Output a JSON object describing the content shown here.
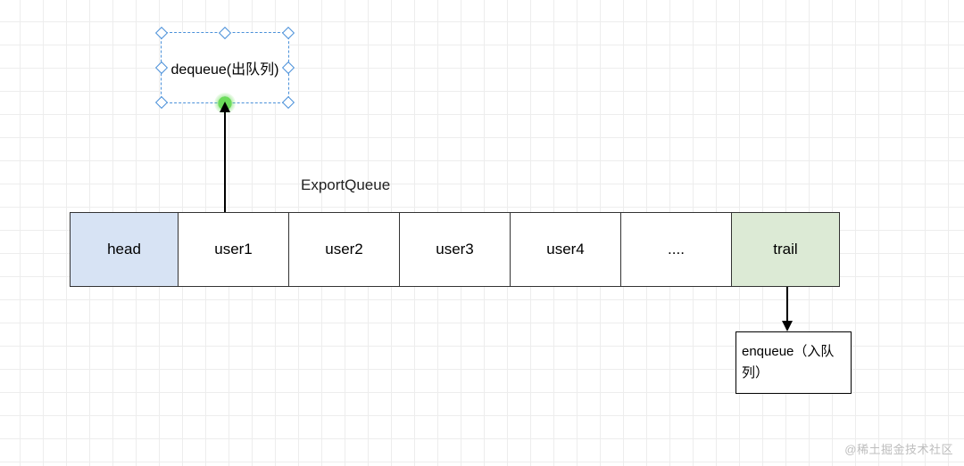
{
  "dequeue": {
    "label": "dequeue(出队列)"
  },
  "queue_title": "ExportQueue",
  "queue": {
    "head": "head",
    "cells": [
      "user1",
      "user2",
      "user3",
      "user4",
      "...."
    ],
    "trail": "trail"
  },
  "enqueue": {
    "label": "enqueue（入队列）"
  },
  "watermark": "@稀土掘金技术社区",
  "chart_data": {
    "type": "diagram",
    "title": "ExportQueue",
    "description": "Queue structure showing head, user slots, and trail; dequeue at head, enqueue at trail.",
    "nodes": [
      {
        "id": "dequeue",
        "label": "dequeue(出队列)",
        "role": "operation",
        "selected": true
      },
      {
        "id": "head",
        "label": "head",
        "role": "pointer",
        "fill": "#d7e3f4"
      },
      {
        "id": "c1",
        "label": "user1",
        "role": "slot"
      },
      {
        "id": "c2",
        "label": "user2",
        "role": "slot"
      },
      {
        "id": "c3",
        "label": "user3",
        "role": "slot"
      },
      {
        "id": "c4",
        "label": "user4",
        "role": "slot"
      },
      {
        "id": "c5",
        "label": "....",
        "role": "slot"
      },
      {
        "id": "trail",
        "label": "trail",
        "role": "pointer",
        "fill": "#dcead5"
      },
      {
        "id": "enqueue",
        "label": "enqueue（入队列）",
        "role": "operation"
      }
    ],
    "edges": [
      {
        "from": "c1",
        "to": "dequeue",
        "direction": "up"
      },
      {
        "from": "trail",
        "to": "enqueue",
        "direction": "down"
      }
    ]
  }
}
